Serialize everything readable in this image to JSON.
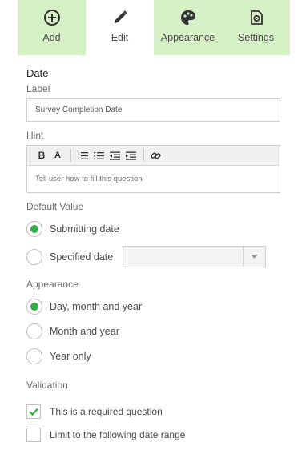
{
  "tabs": [
    {
      "label": "Add",
      "icon": "plus-circle-icon",
      "active": false
    },
    {
      "label": "Edit",
      "icon": "pencil-icon",
      "active": true
    },
    {
      "label": "Appearance",
      "icon": "palette-icon",
      "active": false
    },
    {
      "label": "Settings",
      "icon": "settings-gear-icon",
      "active": false
    }
  ],
  "question": {
    "type_title": "Date",
    "label_caption": "Label",
    "label_value": "Survey Completion Date",
    "hint_caption": "Hint",
    "hint_placeholder": "Tell user how to fill this question",
    "toolbar_bold": "B",
    "toolbar_color": "A"
  },
  "default_value": {
    "caption": "Default Value",
    "options": [
      {
        "label": "Submitting date",
        "selected": true
      },
      {
        "label": "Specified date",
        "selected": false
      }
    ]
  },
  "appearance": {
    "caption": "Appearance",
    "options": [
      {
        "label": "Day, month and year",
        "selected": true
      },
      {
        "label": "Month and year",
        "selected": false
      },
      {
        "label": "Year only",
        "selected": false
      }
    ]
  },
  "validation": {
    "caption": "Validation",
    "options": [
      {
        "label": "This is a required question",
        "checked": true
      },
      {
        "label": "Limit to the following date range",
        "checked": false
      }
    ]
  },
  "colors": {
    "tab_bg": "#d6f0c6",
    "accent": "#35ac46"
  }
}
